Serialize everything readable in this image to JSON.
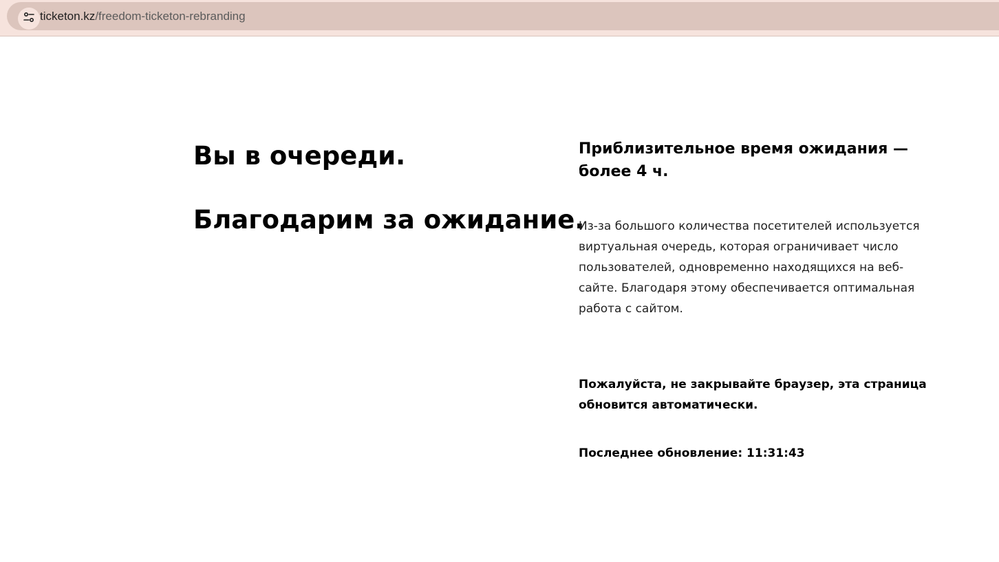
{
  "browser": {
    "url_host": "ticketon.kz",
    "url_path": "/freedom-ticketon-rebranding",
    "site_info_icon": "tune-icon"
  },
  "queue": {
    "headline_1": "Вы в очереди.",
    "headline_2": "Благодарим за ожидание.",
    "wait_time": "Приблизительное время ожидания — более 4 ч.",
    "description": "Из-за большого количества посетителей используется виртуальная очередь, которая ограничивает число пользователей, одновременно находящихся на веб-сайте. Благодаря этому обеспечивается оптимальная работа с сайтом.",
    "notice": "Пожалуйста, не закрывайте браузер, эта страница обновится автоматически.",
    "last_update_label": "Последнее обновление:",
    "last_update_time": "11:31:43"
  }
}
